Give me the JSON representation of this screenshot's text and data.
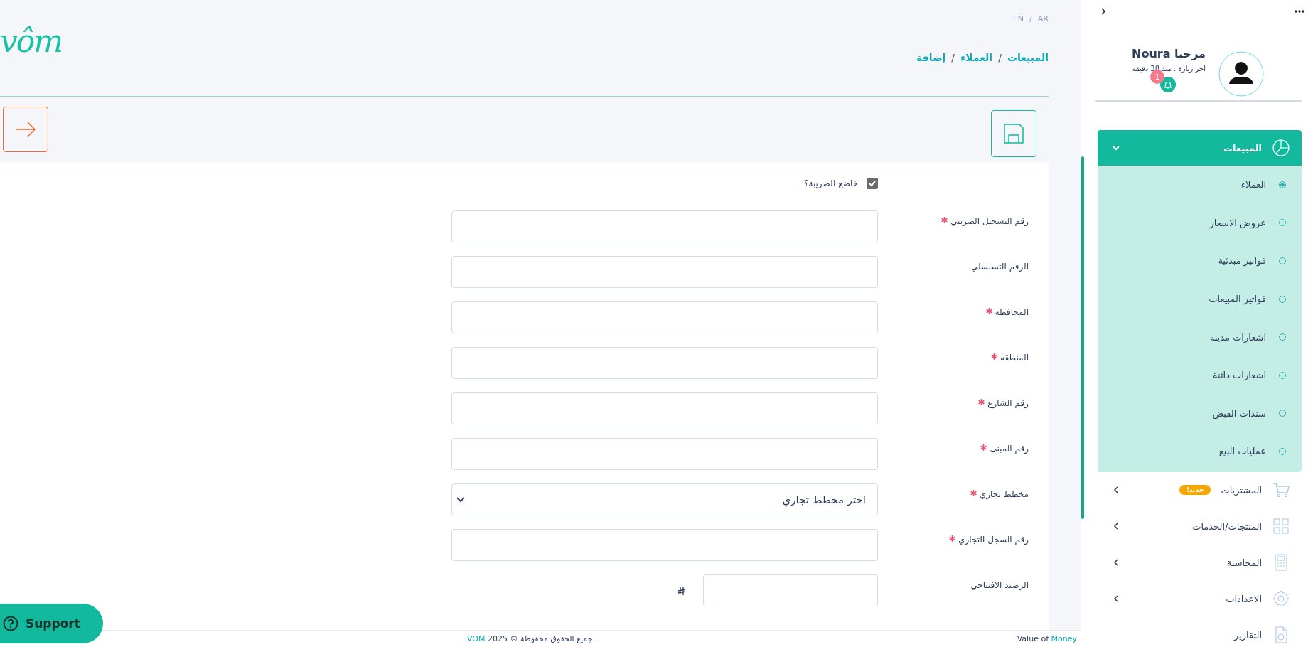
{
  "header": {
    "logo": "vôm",
    "languages": [
      "AR",
      "EN"
    ],
    "language_separator": "/",
    "breadcrumb": [
      "المبيعات",
      "العملاء",
      "إضافة"
    ],
    "breadcrumb_separators": [
      "/",
      "/"
    ]
  },
  "form": {
    "tax_subject": {
      "label": "خاضع للضريبة؟",
      "checked": true
    },
    "fields": [
      {
        "kind": "text",
        "label": "رقم التسجيل الضريبي",
        "required": true
      },
      {
        "kind": "text",
        "label": "الرقم التسلسلي",
        "required": false
      },
      {
        "kind": "text",
        "label": "المحافظه",
        "required": true
      },
      {
        "kind": "text",
        "label": "المنطقه",
        "required": true
      },
      {
        "kind": "text",
        "label": "رقم الشارع",
        "required": true
      },
      {
        "kind": "text",
        "label": "رقم المبنى",
        "required": true
      },
      {
        "kind": "select",
        "label": "مخطط تجاري",
        "required": true,
        "placeholder": "اختر مخطط تجاري"
      },
      {
        "kind": "text",
        "label": "رقم السجل التجاري",
        "required": true
      },
      {
        "kind": "currency",
        "label": "الرصيد الافتتاحي",
        "required": false
      }
    ]
  },
  "support_button": {
    "label": "Support"
  },
  "footer": {
    "copyright_prefix": "جميع الحقوق محفوظة © 2025",
    "copyright_brand": "VOM",
    "copyright_suffix": ".",
    "tagline_prefix": "Value of",
    "tagline_highlight": "Money"
  },
  "sidebar": {
    "greeting": "مرحبا Noura",
    "last_visit": "اخر زيارة : منذ 38 دقيقة",
    "notification_count": "1",
    "menu": [
      {
        "label": "المبيعات",
        "expanded": true,
        "children": [
          {
            "label": "العملاء",
            "selected": true
          },
          {
            "label": "عروض الاسعار",
            "selected": false
          },
          {
            "label": "فواتير مبدئية",
            "selected": false
          },
          {
            "label": "فواتير المبيعات",
            "selected": false
          },
          {
            "label": "اشعارات مدينة",
            "selected": false
          },
          {
            "label": "اشعارات دائنة",
            "selected": false
          },
          {
            "label": "سندات القبض",
            "selected": false
          },
          {
            "label": "عمليات البيع",
            "selected": false
          }
        ]
      },
      {
        "label": "المشتريات",
        "expanded": false,
        "badge": "جديد!"
      },
      {
        "label": "المنتجات/الخدمات",
        "expanded": false
      },
      {
        "label": "المحاسبة",
        "expanded": false
      },
      {
        "label": "الاعدادات",
        "expanded": false
      },
      {
        "label": "التقارير",
        "expanded": false
      }
    ]
  }
}
